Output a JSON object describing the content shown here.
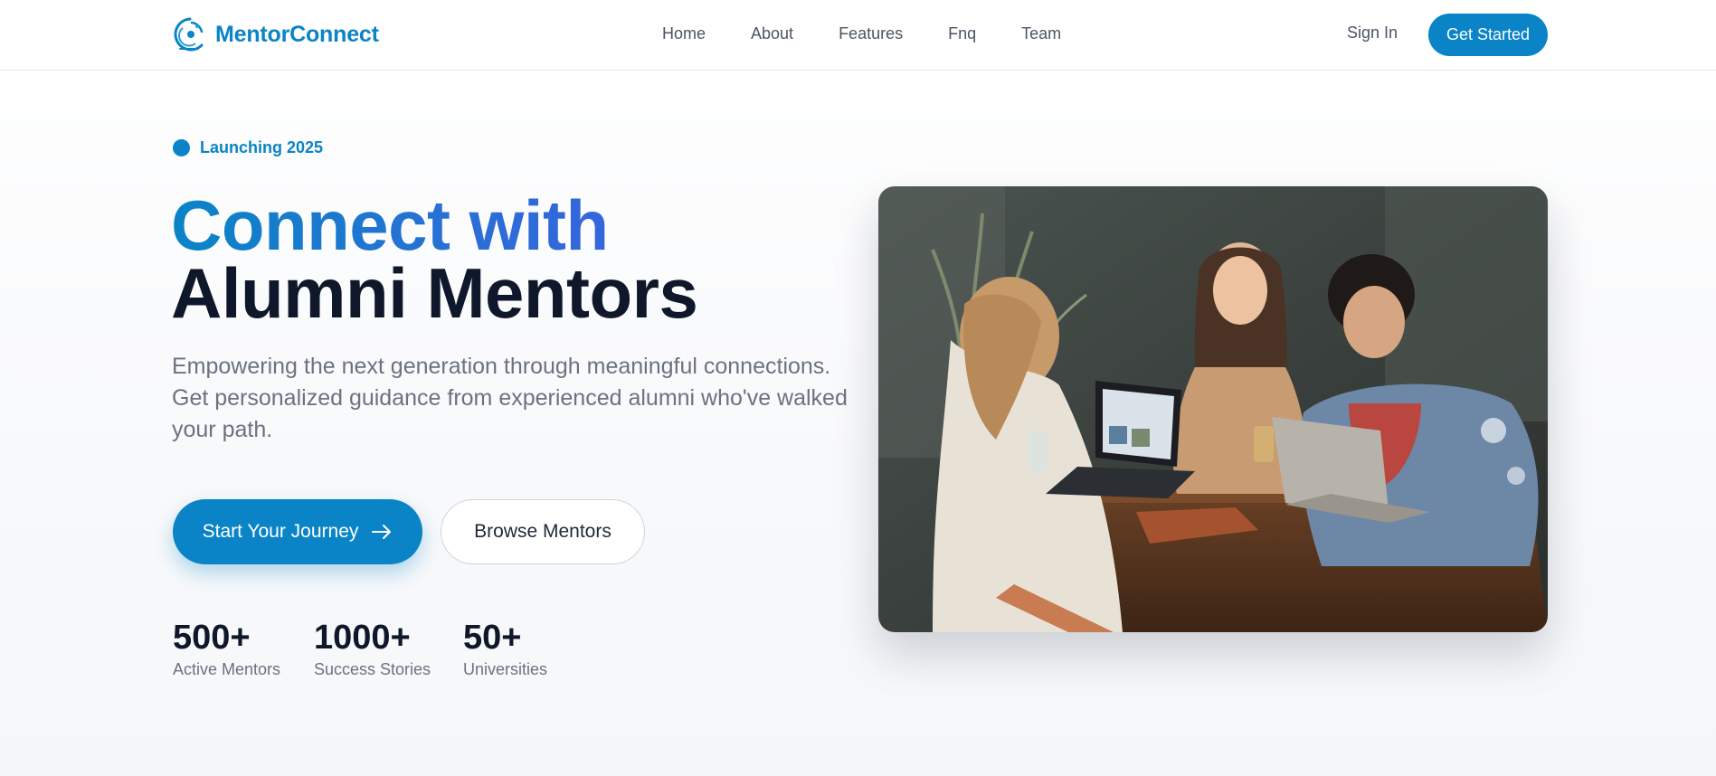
{
  "brand": {
    "name": "MentorConnect",
    "logo_icon": "globe-orbit-logo-icon"
  },
  "nav": {
    "links": [
      {
        "label": "Home"
      },
      {
        "label": "About"
      },
      {
        "label": "Features"
      },
      {
        "label": "Fnq"
      },
      {
        "label": "Team"
      }
    ],
    "sign_in": "Sign In",
    "get_started": "Get Started"
  },
  "hero": {
    "badge": "Launching 2025",
    "headline_line1": "Connect with",
    "headline_line2": "Alumni Mentors",
    "subtitle": "Empowering the next generation through meaningful connections. Get personalized guidance from experienced alumni who've walked your path.",
    "primary_cta": "Start Your Journey",
    "secondary_cta": "Browse Mentors",
    "stats": [
      {
        "value": "500+",
        "label": "Active Mentors"
      },
      {
        "value": "1000+",
        "label": "Success Stories"
      },
      {
        "value": "50+",
        "label": "Universities"
      }
    ],
    "image_subject": "three students laughing around a cafe table with laptops"
  },
  "colors": {
    "primary": "#0a84c6",
    "gradient_end": "#3b5fe0",
    "heading_dark": "#0f172a",
    "muted_text": "#6b7280"
  }
}
